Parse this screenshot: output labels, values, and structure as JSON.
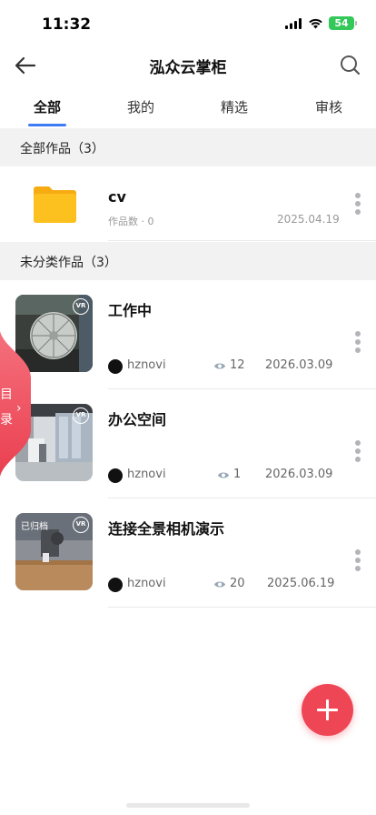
{
  "status_bar": {
    "time": "11:32",
    "battery": "54"
  },
  "nav": {
    "title": "泓众云掌柜"
  },
  "tabs": [
    {
      "label": "全部",
      "active": true
    },
    {
      "label": "我的",
      "active": false
    },
    {
      "label": "精选",
      "active": false
    },
    {
      "label": "审核",
      "active": false
    }
  ],
  "section_all": {
    "label": "全部作品（3）"
  },
  "folder": {
    "name": "cv",
    "count": "作品数 · 0",
    "date": "2025.04.19"
  },
  "section_uncategorized": {
    "label": "未分类作品（3）"
  },
  "works": [
    {
      "title": "工作中",
      "author": "hznovi",
      "views": "12",
      "date": "2026.03.09",
      "archived": ""
    },
    {
      "title": "办公空间",
      "author": "hznovi",
      "views": "1",
      "date": "2026.03.09",
      "archived": ""
    },
    {
      "title": "连接全景相机演示",
      "author": "hznovi",
      "views": "20",
      "date": "2025.06.19",
      "archived": "已归档"
    }
  ],
  "toc": {
    "label": "目录"
  },
  "colors": {
    "accent": "#3d7cf4",
    "fab": "#ef4656",
    "folder": "#fcc11f"
  }
}
